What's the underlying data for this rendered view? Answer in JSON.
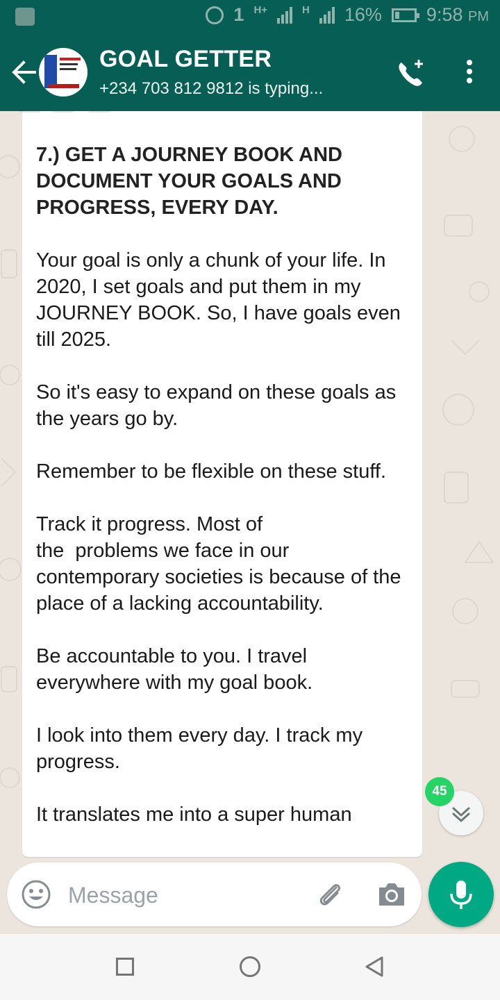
{
  "status_bar": {
    "battery": "16%",
    "time": "9:58",
    "ampm": "PM",
    "net1": "1",
    "net2": "H+",
    "net3": "H"
  },
  "header": {
    "contact_name": "GOAL GETTER",
    "status": "+234 703 812 9812 is typing..."
  },
  "message": {
    "heading": "7.) GET A JOURNEY BOOK AND DOCUMENT YOUR GOALS AND PROGRESS, EVERY DAY.",
    "paragraphs": [
      "Your goal is only a chunk of your life. In 2020, I set goals and put them in my JOURNEY BOOK. So, I have goals even till 2025.",
      "So it's easy to expand on these goals as the years go by.",
      "Remember to be flexible on these stuff.",
      "Track it progress. Most of\nthe  problems we face in our contemporary societies is because of the place of a lacking accountability.",
      "Be accountable to you. I travel everywhere with my goal book.",
      "I look into them every day. I track my progress.",
      "It translates me into a super human"
    ]
  },
  "scroll": {
    "unread_count": "45"
  },
  "input": {
    "placeholder": "Message"
  },
  "colors": {
    "header_bg": "#075e54",
    "chat_bg": "#ece5dd",
    "badge": "#25d366",
    "mic_button": "#00a884"
  }
}
